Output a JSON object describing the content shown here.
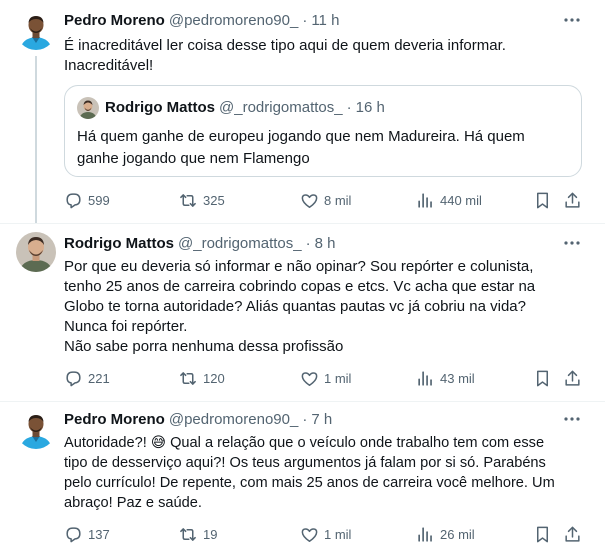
{
  "tweets": [
    {
      "author_name": "Pedro Moreno",
      "handle": "@pedromoreno90_",
      "separator": "·",
      "time": "11 h",
      "lines": [
        "É inacreditável ler coisa desse tipo aqui de quem deveria informar.",
        "Inacreditável!"
      ],
      "quote": {
        "author_name": "Rodrigo Mattos",
        "handle": "@_rodrigomattos_",
        "separator": "·",
        "time": "16 h",
        "lines": [
          "Há quem ganhe de europeu jogando que nem Madureira. Há quem",
          "ganhe jogando que nem Flamengo"
        ]
      },
      "stats": {
        "replies": "599",
        "reposts": "325",
        "likes": "8 mil",
        "views": "440 mil"
      }
    },
    {
      "author_name": "Rodrigo Mattos",
      "handle": "@_rodrigomattos_",
      "separator": "·",
      "time": "8 h",
      "lines": [
        "Por que eu deveria só informar e não opinar? Sou repórter e colunista,",
        "tenho 25 anos de carreira cobrindo copas e etcs. Vc acha que estar na",
        "Globo te torna autoridade? Aliás quantas pautas vc já cobriu na vida?",
        "Nunca foi repórter.",
        "Não sabe porra nenhuma dessa profissão"
      ],
      "stats": {
        "replies": "221",
        "reposts": "120",
        "likes": "1 mil",
        "views": "43 mil"
      }
    },
    {
      "author_name": "Pedro Moreno",
      "handle": "@pedromoreno90_",
      "separator": "·",
      "time": "7 h",
      "lines": [
        "Autoridade?! 😅 Qual a relação que o veículo onde trabalho tem com esse",
        "tipo de desserviço aqui?! Os teus argumentos já falam por si só. Parabéns",
        "pelo currículo! De repente, com mais 25 anos de carreira você melhore. Um",
        "abraço! Paz e saúde."
      ],
      "stats": {
        "replies": "137",
        "reposts": "19",
        "likes": "1 mil",
        "views": "26 mil"
      }
    }
  ],
  "icons": {
    "more": "more-icon",
    "reply": "reply-icon",
    "repost": "repost-icon",
    "like": "like-icon",
    "views": "views-icon",
    "bookmark": "bookmark-icon",
    "share": "share-icon"
  },
  "colors": {
    "text": "#0f1419",
    "secondary": "#536471",
    "border": "#cfd9de",
    "pedro_jersey": "#2aa8e0"
  }
}
